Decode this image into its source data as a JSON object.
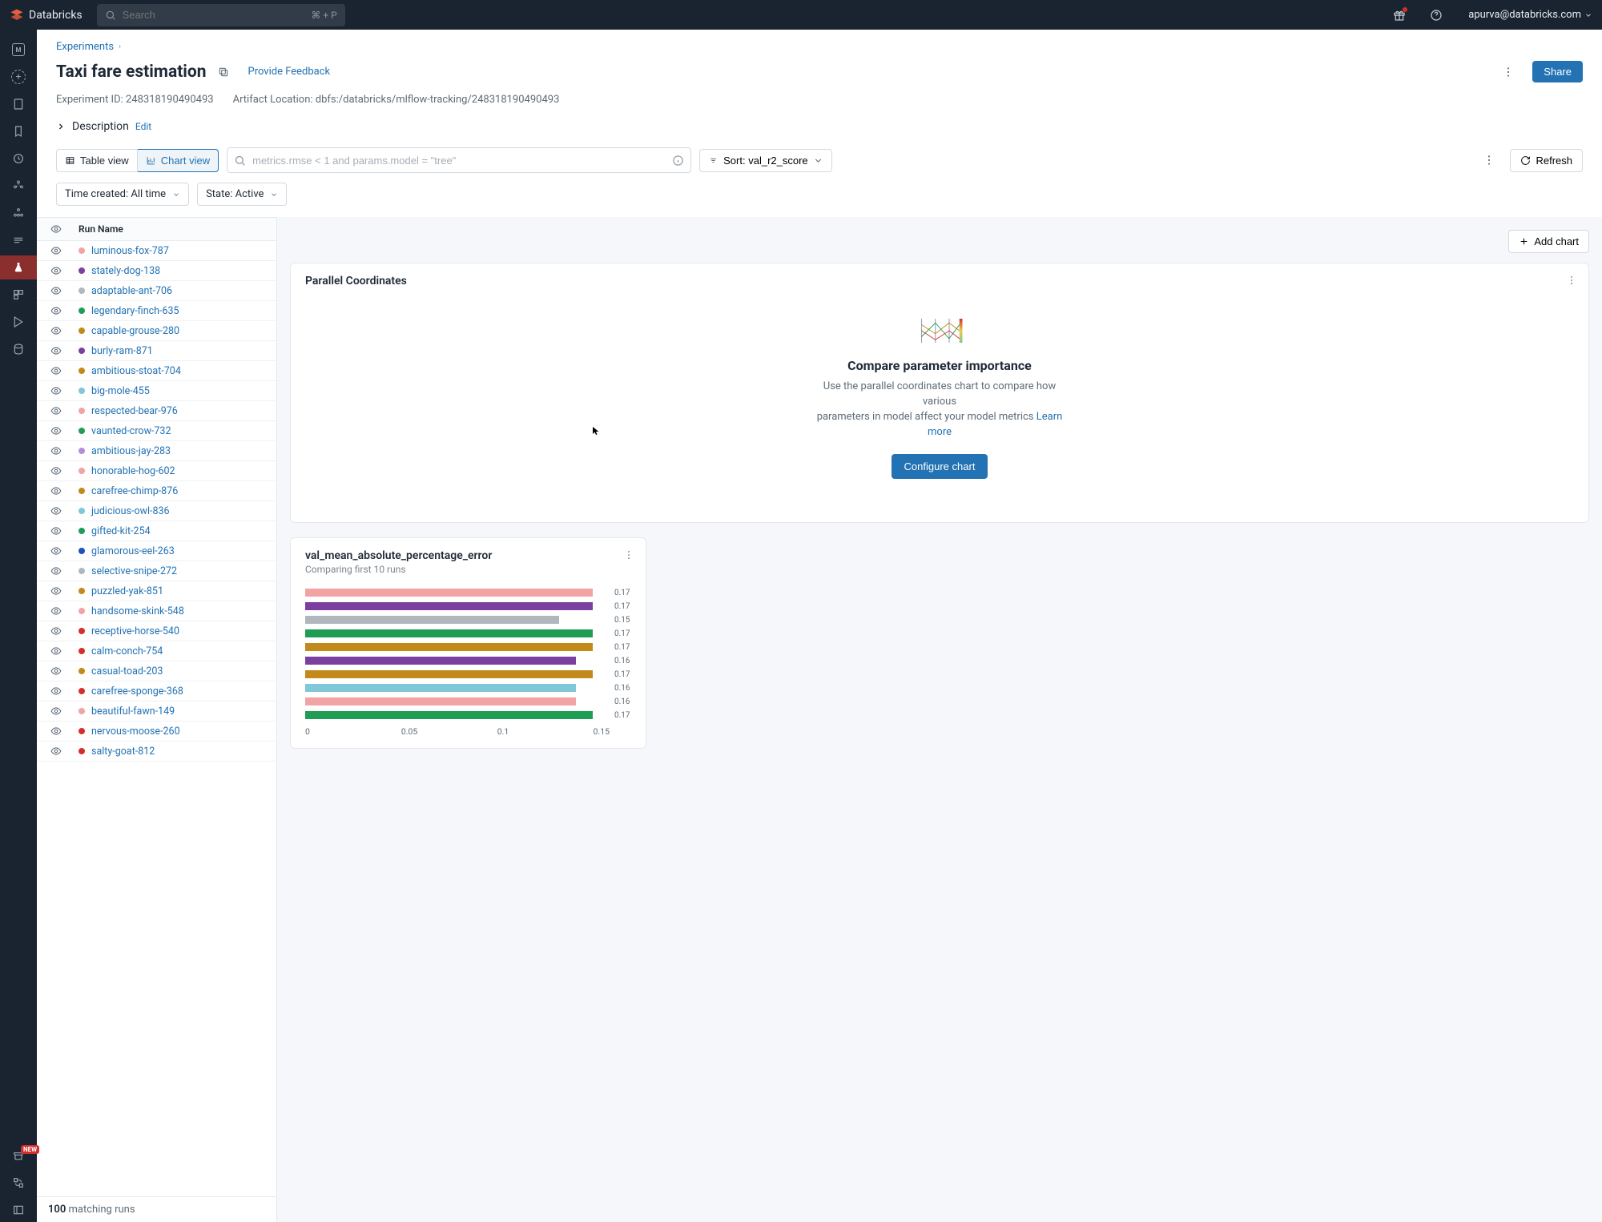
{
  "brand": "Databricks",
  "search": {
    "placeholder": "Search",
    "shortcut": "⌘ + P"
  },
  "user_email": "apurva@databricks.com",
  "breadcrumb": {
    "root": "Experiments"
  },
  "title": "Taxi fare estimation",
  "feedback_label": "Provide Feedback",
  "share_label": "Share",
  "meta": {
    "experiment_id_label": "Experiment ID:",
    "experiment_id": "248318190490493",
    "artifact_label": "Artifact Location:",
    "artifact_location": "dbfs:/databricks/mlflow-tracking/248318190490493"
  },
  "description": {
    "label": "Description",
    "edit": "Edit"
  },
  "toolbar": {
    "table_view": "Table view",
    "chart_view": "Chart view",
    "filter_placeholder": "metrics.rmse < 1 and params.model = \"tree\"",
    "sort_prefix": "Sort:",
    "sort_value": "val_r2_score",
    "refresh": "Refresh"
  },
  "toolbar2": {
    "time_filter": "Time created: All time",
    "state_filter": "State: Active"
  },
  "run_header": "Run Name",
  "runs": [
    {
      "name": "luminous-fox-787",
      "color": "#f2a3a3"
    },
    {
      "name": "stately-dog-138",
      "color": "#7b3fa0"
    },
    {
      "name": "adaptable-ant-706",
      "color": "#b0b7bd"
    },
    {
      "name": "legendary-finch-635",
      "color": "#1f9d55"
    },
    {
      "name": "capable-grouse-280",
      "color": "#c28a1a"
    },
    {
      "name": "burly-ram-871",
      "color": "#7b3fa0"
    },
    {
      "name": "ambitious-stoat-704",
      "color": "#c28a1a"
    },
    {
      "name": "big-mole-455",
      "color": "#7fc7d9"
    },
    {
      "name": "respected-bear-976",
      "color": "#f2a3a3"
    },
    {
      "name": "vaunted-crow-732",
      "color": "#1f9d55"
    },
    {
      "name": "ambitious-jay-283",
      "color": "#b68cd6"
    },
    {
      "name": "honorable-hog-602",
      "color": "#f2a3a3"
    },
    {
      "name": "carefree-chimp-876",
      "color": "#c28a1a"
    },
    {
      "name": "judicious-owl-836",
      "color": "#7fc7d9"
    },
    {
      "name": "gifted-kit-254",
      "color": "#1f9d55"
    },
    {
      "name": "glamorous-eel-263",
      "color": "#1f50c2"
    },
    {
      "name": "selective-snipe-272",
      "color": "#b0b7bd"
    },
    {
      "name": "puzzled-yak-851",
      "color": "#c28a1a"
    },
    {
      "name": "handsome-skink-548",
      "color": "#f2a3a3"
    },
    {
      "name": "receptive-horse-540",
      "color": "#d32f2f"
    },
    {
      "name": "calm-conch-754",
      "color": "#d32f2f"
    },
    {
      "name": "casual-toad-203",
      "color": "#c28a1a"
    },
    {
      "name": "carefree-sponge-368",
      "color": "#d32f2f"
    },
    {
      "name": "beautiful-fawn-149",
      "color": "#f2a3a3"
    },
    {
      "name": "nervous-moose-260",
      "color": "#d32f2f"
    },
    {
      "name": "salty-goat-812",
      "color": "#d32f2f"
    }
  ],
  "matching": {
    "count": "100",
    "label": "matching runs"
  },
  "add_chart_label": "Add chart",
  "pc_card": {
    "title": "Parallel Coordinates",
    "heading": "Compare parameter importance",
    "desc1": "Use the parallel coordinates chart to compare how various",
    "desc2": "parameters in model affect your model metrics",
    "learn": "Learn more",
    "button": "Configure chart"
  },
  "metric_card": {
    "title": "val_mean_absolute_percentage_error",
    "subtitle": "Comparing first 10 runs"
  },
  "chart_data": {
    "type": "bar",
    "title": "val_mean_absolute_percentage_error",
    "xlabel": "",
    "ylabel": "",
    "xlim": [
      0,
      0.18
    ],
    "ticks": [
      "0",
      "0.05",
      "0.1",
      "0.15"
    ],
    "series": [
      {
        "value": 0.17,
        "color": "#f2a3a3",
        "label": "0.17"
      },
      {
        "value": 0.17,
        "color": "#7b3fa0",
        "label": "0.17"
      },
      {
        "value": 0.15,
        "color": "#b0b7bd",
        "label": "0.15"
      },
      {
        "value": 0.17,
        "color": "#1f9d55",
        "label": "0.17"
      },
      {
        "value": 0.17,
        "color": "#c28a1a",
        "label": "0.17"
      },
      {
        "value": 0.16,
        "color": "#7b3fa0",
        "label": "0.16"
      },
      {
        "value": 0.17,
        "color": "#c28a1a",
        "label": "0.17"
      },
      {
        "value": 0.16,
        "color": "#7fc7d9",
        "label": "0.16"
      },
      {
        "value": 0.16,
        "color": "#f2a3a3",
        "label": "0.16"
      },
      {
        "value": 0.17,
        "color": "#1f9d55",
        "label": "0.17"
      }
    ]
  },
  "rail_new": "NEW"
}
